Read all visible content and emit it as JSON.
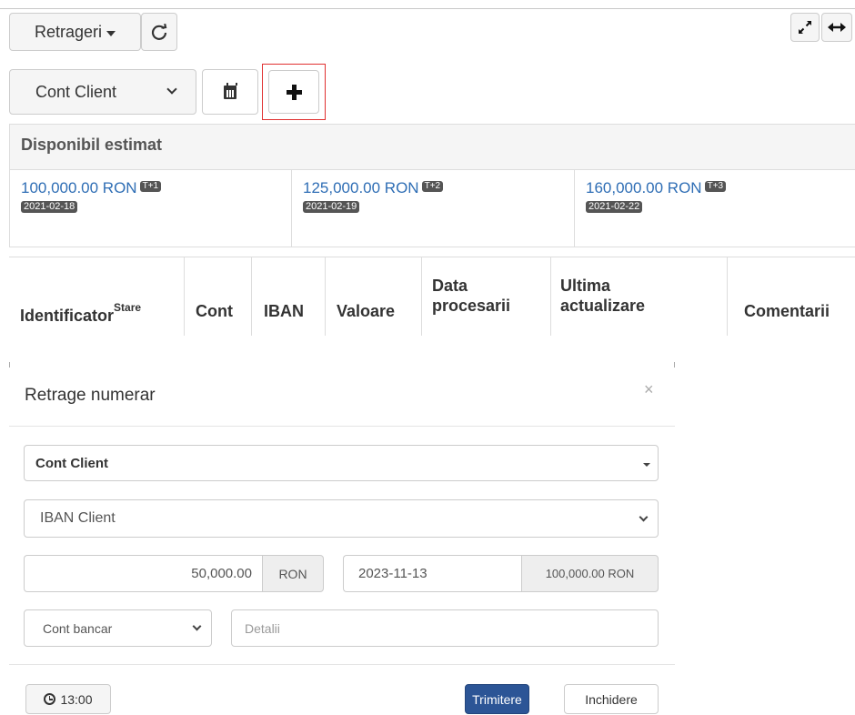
{
  "toolbar": {
    "retrageri_label": "Retrageri",
    "account_select_value": "Cont Client"
  },
  "available": {
    "title": "Disponibil estimat",
    "items": [
      {
        "amount": "100,000.00 RON",
        "tag": "T+1",
        "date": "2021-02-18"
      },
      {
        "amount": "125,000.00 RON",
        "tag": "T+2",
        "date": "2021-02-19"
      },
      {
        "amount": "160,000.00 RON",
        "tag": "T+3",
        "date": "2021-02-22"
      }
    ]
  },
  "table": {
    "headers": {
      "identificator": "Identificator",
      "stare": "Stare",
      "cont": "Cont",
      "iban": "IBAN",
      "valoare": "Valoare",
      "data_procesarii_1": "Data",
      "data_procesarii_2": "procesarii",
      "ultima_actualizare_1": "Ultima",
      "ultima_actualizare_2": "actualizare",
      "comentarii": "Comentarii"
    }
  },
  "modal": {
    "title": "Retrage numerar",
    "close_symbol": "×",
    "account_select": "Cont Client",
    "iban_select": "IBAN Client",
    "amount_value": "50,000.00",
    "currency": "RON",
    "date_value": "2023-11-13",
    "available_value": "100,000.00 RON",
    "bank_select": "Cont bancar",
    "details_placeholder": "Detalii",
    "time_label": "13:00",
    "submit_label": "Trimitere",
    "close_label": "Inchidere"
  },
  "colors": {
    "accent_blue": "#2f6eb5",
    "primary_button": "#2c5596",
    "highlight_red": "#e03030"
  }
}
